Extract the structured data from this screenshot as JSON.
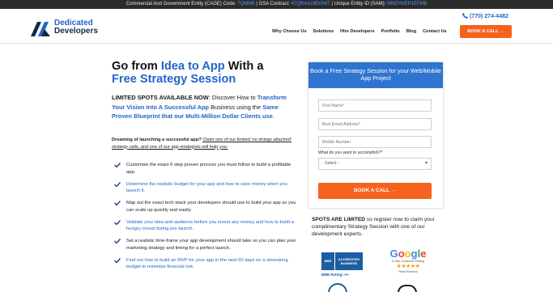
{
  "topbar": {
    "cage_label": "Commercial And Government Entity (CAGE) Code:",
    "cage_value": "7QMM8",
    "gsa_label": "GSA Contract:",
    "gsa_value": "47QRAA19D004T",
    "uei_label": "Unique Entity ID (SAM):",
    "uei_value": "MNEHVEP1EFM8",
    "separator": "|"
  },
  "header": {
    "logo_line1": "Dedicated",
    "logo_line2": "Developers",
    "phone": "(770) 274-4482",
    "nav": [
      "Why Choose Us",
      "Solutions",
      "Hire Developers",
      "Portfolio",
      "Blog",
      "Contact Us"
    ],
    "cta_label": "BOOK A CALL",
    "cta_arrow": "→"
  },
  "hero": {
    "title_part1": "Go from ",
    "title_blue1": "Idea to App",
    "title_part2": " With a ",
    "title_blue2": "Free Strategy Session",
    "intro_bold": "LIMITED SPOTS AVAILABLE NOW",
    "intro_part1": ": Discover How to ",
    "intro_blue1": "Transform Your Vision Into A Successful App",
    "intro_part2": " Business using the ",
    "intro_blue2": "Same Proven Blueprint that our Multi-Million Dollar Clients use",
    "intro_end": ".",
    "dream_bold": "Dreaming of launching a successful app?",
    "dream_underline": "Claim one of our limited 'no strings attached' strategy calls, and one of our app strategists will help you:"
  },
  "checklist": [
    {
      "text": "Customize the exact 6 step proven process you must follow to build a profitable app.",
      "blue": false
    },
    {
      "text": "Determine the realistic budget for your app and how to save money when you launch it.",
      "blue": true
    },
    {
      "text": "Map out the exact tech stack your developers should use to build your app so you can scale up quickly and easily.",
      "blue": false
    },
    {
      "text": "Validate your idea and audience before you invest any money and how to build a hungry crowd during pre-launch.",
      "blue": true
    },
    {
      "text": "Set a realistic time-frame your app development should take so you can plan your marketing strategy and timing for a perfect launch.",
      "blue": false
    },
    {
      "text": "Find out how to build an MVP for your app in the next 60 days on a shoestring budget to minimize financial risk.",
      "blue": true
    }
  ],
  "form": {
    "heading": "Book a Free Strategy Session for your Web/Mobile App Project",
    "first_name_placeholder": "First Name*",
    "email_placeholder": "Best Email Address*",
    "mobile_placeholder": "Mobile Number",
    "question": "What do you want to accomplish?*",
    "select_value": "- Select -",
    "button_label": "BOOK A CALL",
    "button_arrow": "→"
  },
  "spots": {
    "bold": "SPOTS ARE LIMITED",
    "text": " so register now to claim your complimentary Strategy Session with one of our development experts."
  },
  "badges": {
    "bbb_seal": "BBB",
    "bbb_line1": "ACCREDITED",
    "bbb_line2": "BUSINESS",
    "bbb_rating": "BBB Rating: A+",
    "google_word": "Google",
    "google_sub": "5 Star Customer Rating",
    "google_stars": "★★★★★",
    "google_reviews": "Read Reviews"
  },
  "colors": {
    "accent_blue": "#2563c9",
    "cta_orange": "#f5621e",
    "form_header": "#2f74d0",
    "topbar_bg": "#2b2b2b"
  }
}
